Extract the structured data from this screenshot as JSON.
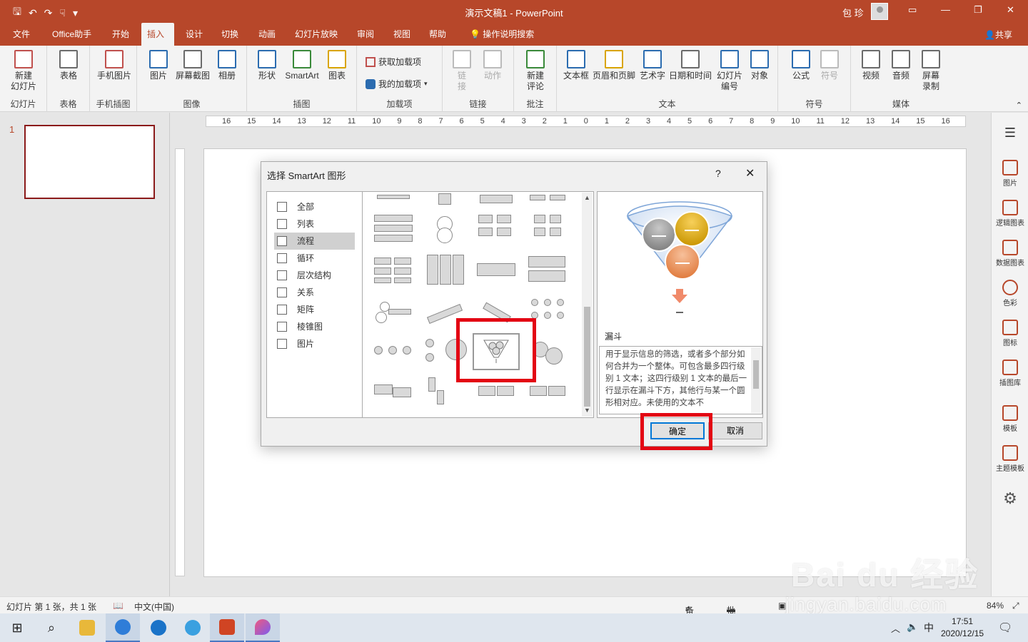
{
  "window": {
    "title": "演示文稿1  -  PowerPoint",
    "user": "包 珍"
  },
  "tabs": [
    "文件",
    "Office助手",
    "开始",
    "插入",
    "设计",
    "切换",
    "动画",
    "幻灯片放映",
    "审阅",
    "视图",
    "帮助",
    "操作说明搜索"
  ],
  "active_tab": "插入",
  "share": "共享",
  "ribbon": {
    "new_slide": "新建\n幻灯片",
    "group_slides": "幻灯片",
    "table": "表格",
    "group_table": "表格",
    "phone_pic": "手机图片",
    "group_phone": "手机插图",
    "picture": "图片",
    "screenshot": "屏幕截图",
    "album": "相册",
    "group_image": "图像",
    "shapes": "形状",
    "smartart": "SmartArt",
    "chart": "图表",
    "group_illus": "插图",
    "get_addins": "获取加载项",
    "my_addins": "我的加载项",
    "group_addins": "加载项",
    "link": "链\n接",
    "action": "动作",
    "group_links": "链接",
    "new_comment": "新建\n评论",
    "group_comments": "批注",
    "textbox": "文本框",
    "header_footer": "页眉和页脚",
    "wordart": "艺术字",
    "datetime": "日期和时间",
    "slide_number": "幻灯片\n编号",
    "object": "对象",
    "group_text": "文本",
    "equation": "公式",
    "symbol": "符号",
    "group_symbols": "符号",
    "video": "视频",
    "audio": "音频",
    "screen_record": "屏幕\n录制",
    "group_media": "媒体"
  },
  "ruler": [
    "16",
    "15",
    "14",
    "13",
    "12",
    "11",
    "10",
    "9",
    "8",
    "7",
    "6",
    "5",
    "4",
    "3",
    "2",
    "1",
    "0",
    "1",
    "2",
    "3",
    "4",
    "5",
    "6",
    "7",
    "8",
    "9",
    "10",
    "11",
    "12",
    "13",
    "14",
    "15",
    "16"
  ],
  "slide_pane": {
    "number": "1"
  },
  "right_rail": [
    "图片",
    "逻辑图表",
    "数据图表",
    "色彩",
    "图标",
    "插图库",
    "模板",
    "主题模板"
  ],
  "dialog": {
    "title": "选择 SmartArt 图形",
    "help": "?",
    "categories": [
      "全部",
      "列表",
      "流程",
      "循环",
      "层次结构",
      "关系",
      "矩阵",
      "棱锥图",
      "图片"
    ],
    "selected_category": "流程",
    "preview_name": "漏斗",
    "preview_desc": "用于显示信息的筛选，或者多个部分如何合并为一个整体。可包含最多四行级别 1 文本；这四行级别 1 文本的最后一行显示在漏斗下方，其他行与某一个圆形相对应。未使用的文本不",
    "ok": "确定",
    "cancel": "取消"
  },
  "status": {
    "slide": "幻灯片 第 1 张，共 1 张",
    "lang": "中文(中国)",
    "notes": "备注",
    "comments": "批注",
    "zoom": "84%"
  },
  "taskbar": {
    "ime": "中",
    "time": "17:51",
    "date": "2020/12/15"
  },
  "watermark": {
    "brand": "Bai du 经验",
    "url": "jingyan.baidu.com"
  }
}
